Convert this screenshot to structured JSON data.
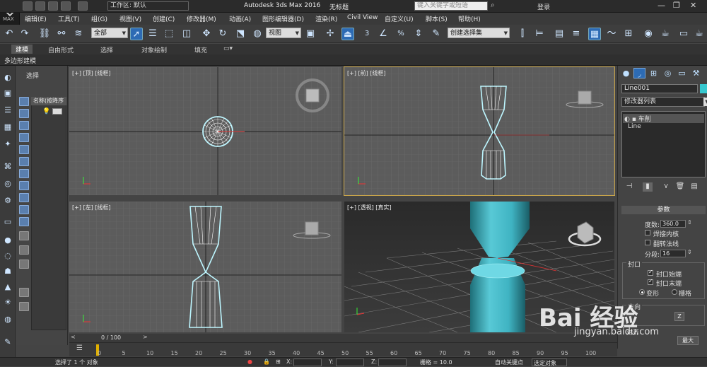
{
  "title": {
    "workspace_label": "工作区: 默认",
    "app_name": "Autodesk 3ds Max 2016",
    "document": "无标题",
    "search_placeholder": "键入关键字或短语",
    "login": "登录"
  },
  "menu": [
    "编辑(E)",
    "工具(T)",
    "组(G)",
    "视图(V)",
    "创建(C)",
    "修改器(M)",
    "动画(A)",
    "图形编辑器(D)",
    "渲染(R)",
    "Civil View",
    "自定义(U)",
    "脚本(S)",
    "帮助(H)"
  ],
  "toolbar": {
    "selection_filter": "全部",
    "reference_coord": "视图",
    "named_selection": "创建选择集",
    "snap_value": "3",
    "percent_snap": "%"
  },
  "ribbon": {
    "tabs": [
      "建模",
      "自由形式",
      "选择",
      "对象绘制",
      "填充"
    ],
    "active_tab": "建模",
    "sub_label": "多边形建模"
  },
  "scene_explorer": {
    "title": "选择",
    "column_header": "名称(按降序"
  },
  "viewports": {
    "top": "[+] [顶] [线框]",
    "front": "[+] [前] [线框]",
    "left": "[+] [左] [线框]",
    "perspective": "[+] [透视] [真实]"
  },
  "command_panel": {
    "object_name": "Line001",
    "object_color": "#37c8cf",
    "modifier_list": "修改器列表",
    "stack": [
      "车削",
      "Line"
    ],
    "params_title": "参数",
    "degrees_label": "度数:",
    "degrees_value": "360.0",
    "weld_core": "焊接内核",
    "flip_normals": "翻转法线",
    "segments_label": "分段:",
    "segments_value": "16",
    "capping_title": "封口",
    "cap_start": "封口始端",
    "cap_end": "封口末端",
    "morph": "变形",
    "grid": "栅格",
    "direction_title": "方向",
    "axis_z": "Z",
    "align_title": "对齐",
    "align_max": "最大"
  },
  "timeline": {
    "frame": "0 / 100",
    "ticks": [
      "0",
      "5",
      "10",
      "15",
      "20",
      "25",
      "30",
      "35",
      "40",
      "45",
      "50",
      "55",
      "60",
      "65",
      "70",
      "75",
      "80",
      "85",
      "90",
      "95",
      "100"
    ]
  },
  "status": {
    "message": "选择了 1 个 对象",
    "x_label": "X:",
    "y_label": "Y:",
    "z_label": "Z:",
    "grid": "栅格 = 10.0",
    "auto_key": "自动关键点",
    "selected_obj": "选定对象"
  },
  "watermark": {
    "brand": "Bai 经验",
    "url": "jingyan.baidu.com"
  },
  "colors": {
    "accent": "#2d6bb4",
    "object": "#37c8cf",
    "active_border": "#c9a54a"
  }
}
